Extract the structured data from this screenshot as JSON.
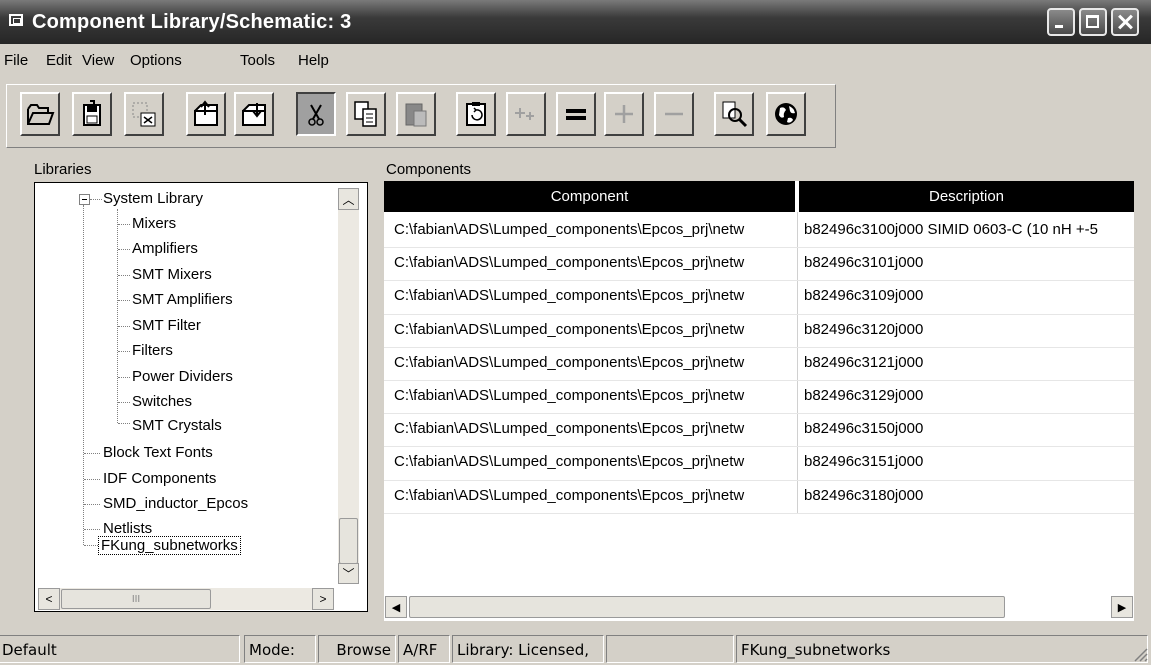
{
  "window": {
    "title": "Component Library/Schematic: 3",
    "buttons": [
      "minimize-icon",
      "maximize-icon",
      "close-icon"
    ]
  },
  "menu": [
    "File",
    "Edit",
    "View",
    "Options",
    "Tools",
    "Help"
  ],
  "toolbar": {
    "tools": [
      {
        "name": "open-folder-icon"
      },
      {
        "name": "save-disk-icon"
      },
      {
        "name": "close-library-icon"
      },
      {
        "name": "library-up-icon"
      },
      {
        "name": "library-down-icon"
      },
      {
        "name": "cut-icon",
        "pressed": true
      },
      {
        "name": "copy-icon"
      },
      {
        "name": "paste-icon",
        "disabled": true
      },
      {
        "name": "clipboard-refresh-icon"
      },
      {
        "name": "expand-all-icon",
        "disabled": true
      },
      {
        "name": "collapse-all-icon"
      },
      {
        "name": "plus-icon",
        "disabled": true
      },
      {
        "name": "minus-icon",
        "disabled": true
      },
      {
        "name": "search-icon"
      },
      {
        "name": "globe-icon"
      }
    ]
  },
  "libraries": {
    "label": "Libraries",
    "tree": [
      {
        "label": "System Library",
        "level": 0,
        "expanded": true
      },
      {
        "label": "Mixers",
        "level": 1
      },
      {
        "label": "Amplifiers",
        "level": 1
      },
      {
        "label": "SMT Mixers",
        "level": 1
      },
      {
        "label": "SMT Amplifiers",
        "level": 1
      },
      {
        "label": "SMT Filter",
        "level": 1
      },
      {
        "label": "Filters",
        "level": 1
      },
      {
        "label": "Power Dividers",
        "level": 1
      },
      {
        "label": "Switches",
        "level": 1
      },
      {
        "label": "SMT Crystals",
        "level": 1
      },
      {
        "label": "Block Text Fonts",
        "level": 0
      },
      {
        "label": "IDF Components",
        "level": 0
      },
      {
        "label": "SMD_inductor_Epcos",
        "level": 0
      },
      {
        "label": "Netlists",
        "level": 0
      },
      {
        "label": "FKung_subnetworks",
        "level": 0,
        "selected": true
      }
    ],
    "scroll": {
      "hthumb_label": "III"
    }
  },
  "components": {
    "label": "Components",
    "columns": [
      "Component",
      "Description"
    ],
    "rows": [
      {
        "component": "C:\\fabian\\ADS\\Lumped_components\\Epcos_prj\\netw",
        "description": "b82496c3100j000 SIMID 0603-C (10 nH +-5"
      },
      {
        "component": "C:\\fabian\\ADS\\Lumped_components\\Epcos_prj\\netw",
        "description": "b82496c3101j000"
      },
      {
        "component": "C:\\fabian\\ADS\\Lumped_components\\Epcos_prj\\netw",
        "description": "b82496c3109j000"
      },
      {
        "component": "C:\\fabian\\ADS\\Lumped_components\\Epcos_prj\\netw",
        "description": "b82496c3120j000"
      },
      {
        "component": "C:\\fabian\\ADS\\Lumped_components\\Epcos_prj\\netw",
        "description": "b82496c3121j000"
      },
      {
        "component": "C:\\fabian\\ADS\\Lumped_components\\Epcos_prj\\netw",
        "description": "b82496c3129j000"
      },
      {
        "component": "C:\\fabian\\ADS\\Lumped_components\\Epcos_prj\\netw",
        "description": "b82496c3150j000"
      },
      {
        "component": "C:\\fabian\\ADS\\Lumped_components\\Epcos_prj\\netw",
        "description": "b82496c3151j000"
      },
      {
        "component": "C:\\fabian\\ADS\\Lumped_components\\Epcos_prj\\netw",
        "description": "b82496c3180j000"
      }
    ]
  },
  "status": {
    "panel1": "Default",
    "mode_label": "Mode:",
    "mode_value": "Browse",
    "rf": "A/RF",
    "library": "Library: Licensed,",
    "empty": "",
    "current": "FKung_subnetworks"
  }
}
